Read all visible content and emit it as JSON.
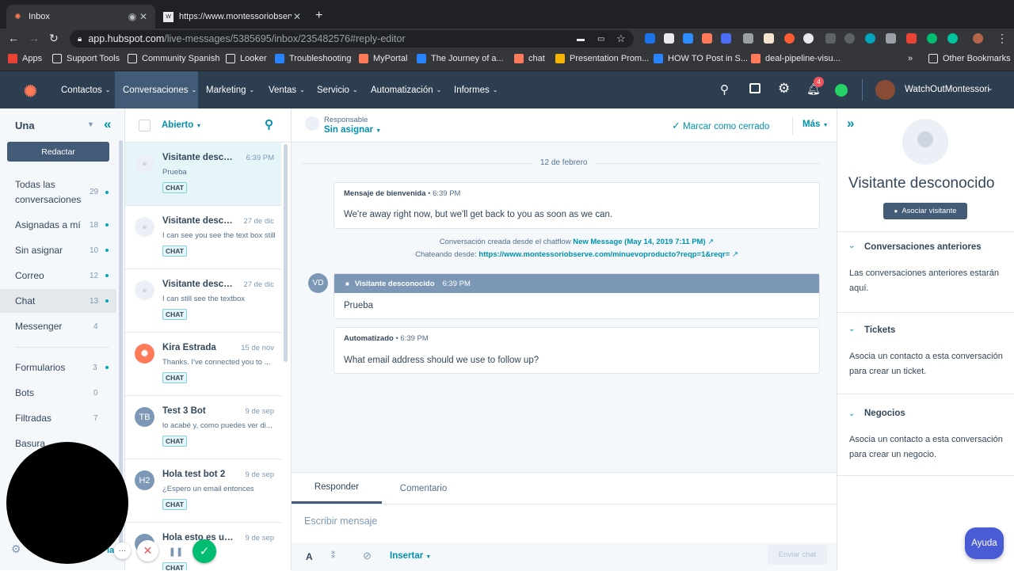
{
  "browser": {
    "tabs": [
      {
        "title": "Inbox",
        "active": true
      },
      {
        "title": "https://www.montessoriobserve",
        "active": false
      }
    ],
    "url_host": "app.hubspot.com",
    "url_path": "/live-messages/5385695/inbox/235482576#reply-editor",
    "bookmarks": [
      "Apps",
      "Support Tools",
      "Community Spanish",
      "Looker",
      "Troubleshooting",
      "MyPortal",
      "The Journey of a...",
      "chat",
      "Presentation Prom...",
      "HOW TO Post in S...",
      "deal-pipeline-visu..."
    ],
    "more_bookmarks": "»",
    "other_bookmarks": "Other Bookmarks"
  },
  "topnav": {
    "items": [
      "Contactos",
      "Conversaciones",
      "Marketing",
      "Ventas",
      "Servicio",
      "Automatización",
      "Informes"
    ],
    "notification_count": "4",
    "account_name": "WatchOutMontessori"
  },
  "sidebar": {
    "inbox_name": "Una",
    "compose_label": "Redactar",
    "items": [
      {
        "label": "Todas las",
        "label2": "conversaciones",
        "count": "29",
        "dot": true
      },
      {
        "label": "Asignadas a mí",
        "count": "18",
        "dot": true
      },
      {
        "label": "Sin asignar",
        "count": "10",
        "dot": true
      },
      {
        "label": "Correo",
        "count": "12",
        "dot": true
      },
      {
        "label": "Chat",
        "count": "13",
        "dot": true
      },
      {
        "label": "Messenger",
        "count": "4",
        "dot": false
      },
      {
        "label": "Formularios",
        "count": "3",
        "dot": true
      },
      {
        "label": "Bots",
        "count": "0",
        "dot": false
      },
      {
        "label": "Filtradas",
        "count": "7",
        "dot": false
      },
      {
        "label": "Basura",
        "count": "",
        "dot": false
      }
    ],
    "footer_fragment": "la",
    "footer_more": "···"
  },
  "convlist": {
    "filter_label": "Abierto",
    "items": [
      {
        "name": "Visitante desco...",
        "date": "6:39 PM",
        "preview": "Prueba",
        "tag": "CHAT",
        "avatar": "",
        "avatar_color": "#eaf0f6"
      },
      {
        "name": "Visitante desco...",
        "date": "27 de dic",
        "preview": "I can see you see the text box still",
        "tag": "CHAT",
        "avatar": "",
        "avatar_color": "#eaf0f6"
      },
      {
        "name": "Visitante desco...",
        "date": "27 de dic",
        "preview": "I can still see the textbox",
        "tag": "CHAT",
        "avatar": "",
        "avatar_color": "#eaf0f6"
      },
      {
        "name": "Kira Estrada",
        "date": "15 de nov",
        "preview": "Thanks. I've connected you to ...",
        "tag": "CHAT",
        "avatar": "",
        "avatar_color": "#ff7a59"
      },
      {
        "name": "Test 3 Bot",
        "date": "9 de sep",
        "preview": "lo acabé y, como puedes ver di...",
        "tag": "CHAT",
        "avatar": "TB",
        "avatar_color": "#7c98b6"
      },
      {
        "name": "Hola test bot 2",
        "date": "9 de sep",
        "preview": "¿Espero un email entonces",
        "tag": "CHAT",
        "avatar": "H2",
        "avatar_color": "#7c98b6"
      },
      {
        "name": "Hola esto es un ...",
        "date": "9 de sep",
        "preview": "",
        "tag": "CHAT",
        "avatar": "",
        "avatar_color": "#7c98b6"
      }
    ]
  },
  "thread": {
    "owner_label": "Responsable",
    "owner_value": "Sin asignar",
    "close_label": "Marcar como cerrado",
    "more_label": "Más",
    "date_divider": "12 de febrero",
    "welcome": {
      "title": "Mensaje de bienvenida",
      "time": "6:39 PM",
      "body": "We're away right now, but we'll get back to you as soon as we can."
    },
    "info_line1_prefix": "Conversación creada desde el chatflow",
    "info_line1_link": "New Message (May 14, 2019 7:11 PM)",
    "info_line2_prefix": "Chateando desde:",
    "info_line2_link": "https://www.montessoriobserve.com/minuevoproducto?reqp=1&reqr=",
    "visitor": {
      "initials": "VD",
      "name": "Visitante desconocido",
      "time": "6:39 PM",
      "body": "Prueba"
    },
    "auto": {
      "title": "Automatizado",
      "time": "6:39 PM",
      "body": "What email address should we use to follow up?"
    },
    "tabs": [
      "Responder",
      "Comentario"
    ],
    "input_placeholder": "Escribir mensaje",
    "insert_label": "Insertar",
    "send_label": "Enviar chat"
  },
  "rpanel": {
    "contact_name": "Visitante desconocido",
    "associate_label": "Asociar visitante",
    "sections": [
      {
        "title": "Conversaciones anteriores",
        "desc": "Las conversaciones anteriores estarán aquí."
      },
      {
        "title": "Tickets",
        "desc": "Asocia un contacto a esta conversación para crear un ticket."
      },
      {
        "title": "Negocios",
        "desc": "Asocia un contacto a esta conversación para crear un negocio."
      }
    ],
    "help_label": "Ayuda"
  },
  "colors": {
    "hubspot_orange": "#ff7a59",
    "nav_bg": "#2d3e50",
    "teal": "#00a4bd",
    "link": "#0091ae",
    "green": "#00bd72"
  }
}
